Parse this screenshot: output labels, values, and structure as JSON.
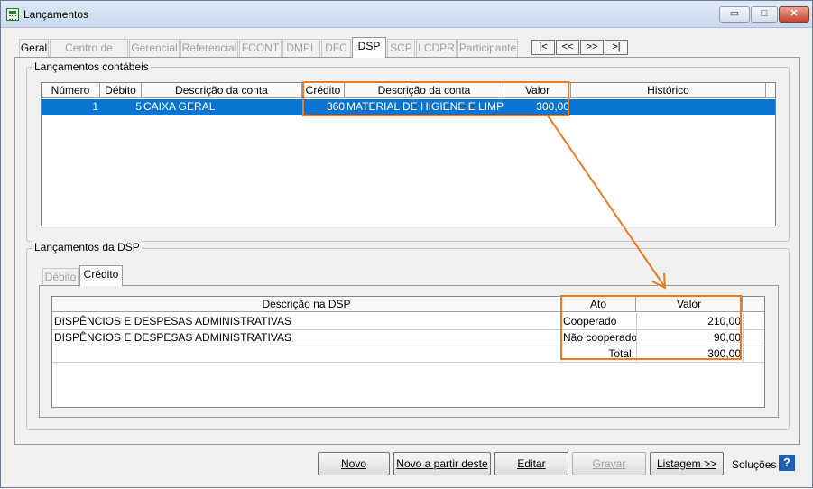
{
  "window": {
    "title": "Lançamentos",
    "min": "▭",
    "max": "□",
    "close": "✕"
  },
  "tabs": [
    {
      "label": "Geral",
      "state": "enabled"
    },
    {
      "label": "Centro de Custo",
      "state": "disabled"
    },
    {
      "label": "Gerencial",
      "state": "disabled"
    },
    {
      "label": "Referencial",
      "state": "disabled"
    },
    {
      "label": "FCONT",
      "state": "disabled"
    },
    {
      "label": "DMPL",
      "state": "disabled"
    },
    {
      "label": "DFC",
      "state": "disabled"
    },
    {
      "label": "DSP",
      "state": "active"
    },
    {
      "label": "SCP",
      "state": "disabled"
    },
    {
      "label": "LCDPR",
      "state": "disabled"
    },
    {
      "label": "Participante",
      "state": "disabled"
    }
  ],
  "nav": {
    "first": "|<",
    "prev": "<<",
    "next": ">>",
    "last": ">|"
  },
  "lancamentos": {
    "title": "Lançamentos contábeis",
    "columns": [
      "Número",
      "Débito",
      "Descrição da conta",
      "Crédito",
      "Descrição da conta",
      "Valor",
      "Histórico"
    ],
    "row": {
      "numero": "1",
      "debito": "5",
      "desc_debito": "CAIXA GERAL",
      "credito": "360",
      "desc_credito": "MATERIAL DE HIGIENE E LIMPEZA",
      "valor": "300,00",
      "historico": ""
    }
  },
  "dsp": {
    "title": "Lançamentos da DSP",
    "tabs": {
      "debito": "Débito",
      "credito": "Crédito"
    },
    "columns": {
      "descricao": "Descrição na DSP",
      "ato": "Ato",
      "valor": "Valor"
    },
    "rows": [
      {
        "descricao": "DISPÊNCIOS E DESPESAS ADMINISTRATIVAS",
        "ato": "Cooperado",
        "valor": "210,00"
      },
      {
        "descricao": "DISPÊNCIOS E DESPESAS ADMINISTRATIVAS",
        "ato": "Não cooperado",
        "valor": "90,00"
      }
    ],
    "total": {
      "label": "Total:",
      "valor": "300,00"
    }
  },
  "buttons": {
    "novo": "Novo",
    "novo_partir": "Novo a partir deste",
    "editar": "Editar",
    "gravar": "Gravar",
    "listagem": "Listagem >>",
    "solucoes": "Soluções",
    "help": "?"
  },
  "accent": "#f07a1f",
  "selection": "#0a74d3"
}
